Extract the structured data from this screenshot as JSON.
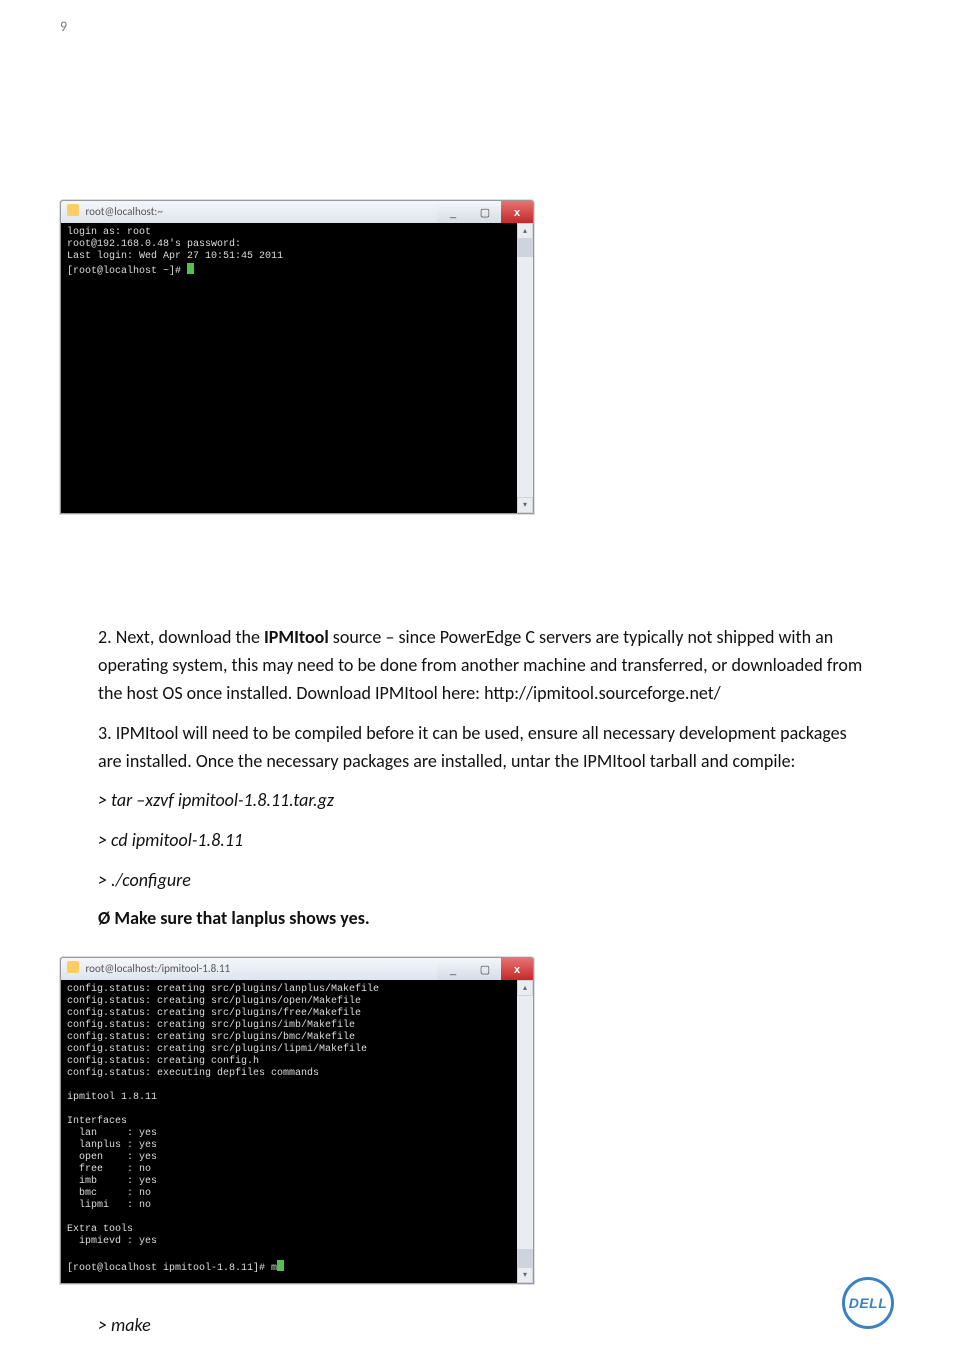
{
  "page_number": "9",
  "screenshot1": {
    "title": "root@localhost:~",
    "icon_name": "putty-icon",
    "buttons": {
      "min": "_",
      "max": "▢",
      "close": "x"
    },
    "scroll": {
      "up": "▴",
      "down": "▾"
    },
    "lines": [
      "login as: root",
      "root@192.168.0.48's password:",
      "Last login: Wed Apr 27 10:51:45 2011",
      "[root@localhost ~]# "
    ]
  },
  "step2": {
    "label": "2.",
    "pre": "Next, download the ",
    "a": "IPMItool",
    "mid": " source – since PowerEdge C servers are typically not shipped with an operating system, this may need to be done from another machine and transferred, or downloaded from the host OS once installed. Download IPMItool here: ",
    "url": "http://ipmitool.sourceforge.net/"
  },
  "step3": {
    "label": "3.",
    "text": "IPMItool will need to be compiled before it can be used, ensure all necessary development packages are installed. Once the necessary packages are installed, untar the IPMItool tarball and compile:"
  },
  "step3_cmds": [
    "> tar –xzvf ipmitool-1.8.11.tar.gz",
    "> cd ipmitool-1.8.11",
    "> ./configure"
  ],
  "note_bold": "Ø",
  "note_text": " Make sure that lanplus shows yes.",
  "screenshot2": {
    "title": "root@localhost:/ipmitool-1.8.11",
    "icon_name": "putty-icon",
    "buttons": {
      "min": "_",
      "max": "▢",
      "close": "x"
    },
    "scroll": {
      "up": "▴",
      "down": "▾"
    },
    "lines": [
      "config.status: creating src/plugins/lanplus/Makefile",
      "config.status: creating src/plugins/open/Makefile",
      "config.status: creating src/plugins/free/Makefile",
      "config.status: creating src/plugins/imb/Makefile",
      "config.status: creating src/plugins/bmc/Makefile",
      "config.status: creating src/plugins/lipmi/Makefile",
      "config.status: creating config.h",
      "config.status: executing depfiles commands",
      "",
      "ipmitool 1.8.11",
      "",
      "Interfaces",
      "  lan     : yes",
      "  lanplus : yes",
      "  open    : yes",
      "  free    : no",
      "  imb     : yes",
      "  bmc     : no",
      "  lipmi   : no",
      "",
      "Extra tools",
      "  ipmievd : yes",
      "",
      "[root@localhost ipmitool-1.8.11]# m"
    ]
  },
  "step4": "> make",
  "dell": "DELL"
}
